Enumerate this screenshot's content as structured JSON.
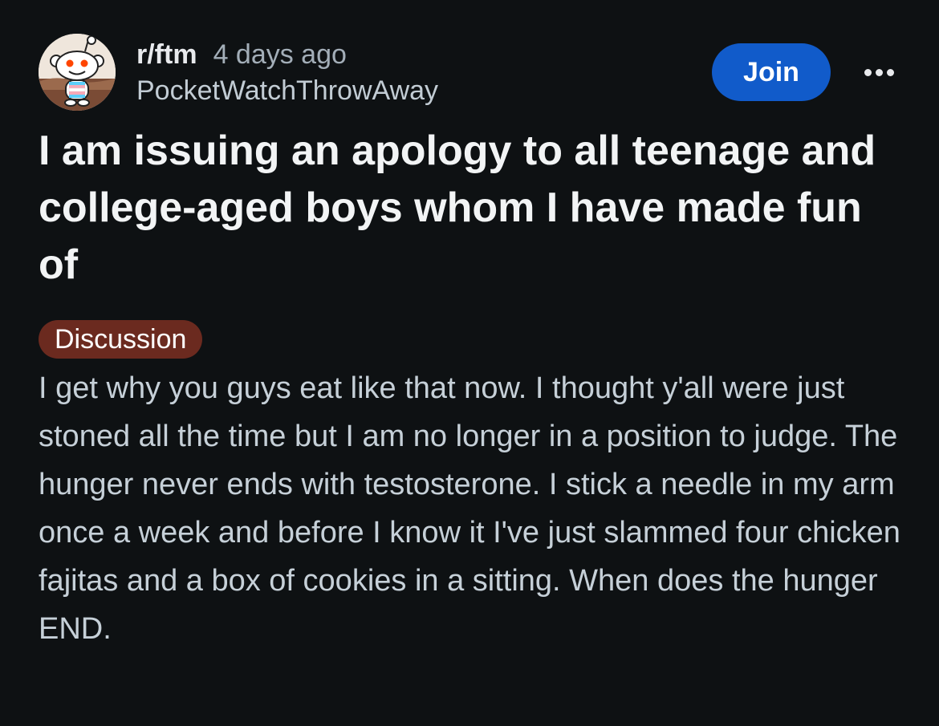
{
  "header": {
    "subreddit": "r/ftm",
    "time_ago": "4 days ago",
    "username": "PocketWatchThrowAway",
    "join_label": "Join",
    "avatar_icon": "reddit-snoo-avatar",
    "more_icon": "more-horizontal-icon"
  },
  "post": {
    "title": "I am issuing an apology to all teenage and college-aged boys whom I have made fun of",
    "flair": "Discussion",
    "body": "I get why you guys eat like that now. I thought y'all were just stoned all the time but I am no longer in a position to judge. The hunger never ends with testosterone. I stick a needle in my arm once a week and before I know it I've just slammed four chicken fajitas and a box of cookies in a sitting. When does the hunger END."
  },
  "colors": {
    "background": "#0e1113",
    "join_button": "#115bca",
    "flair_background": "#6b2a1f",
    "title_text": "#f2f4f5",
    "body_text": "#c6d0d8",
    "muted_text": "#a3aeb8"
  }
}
